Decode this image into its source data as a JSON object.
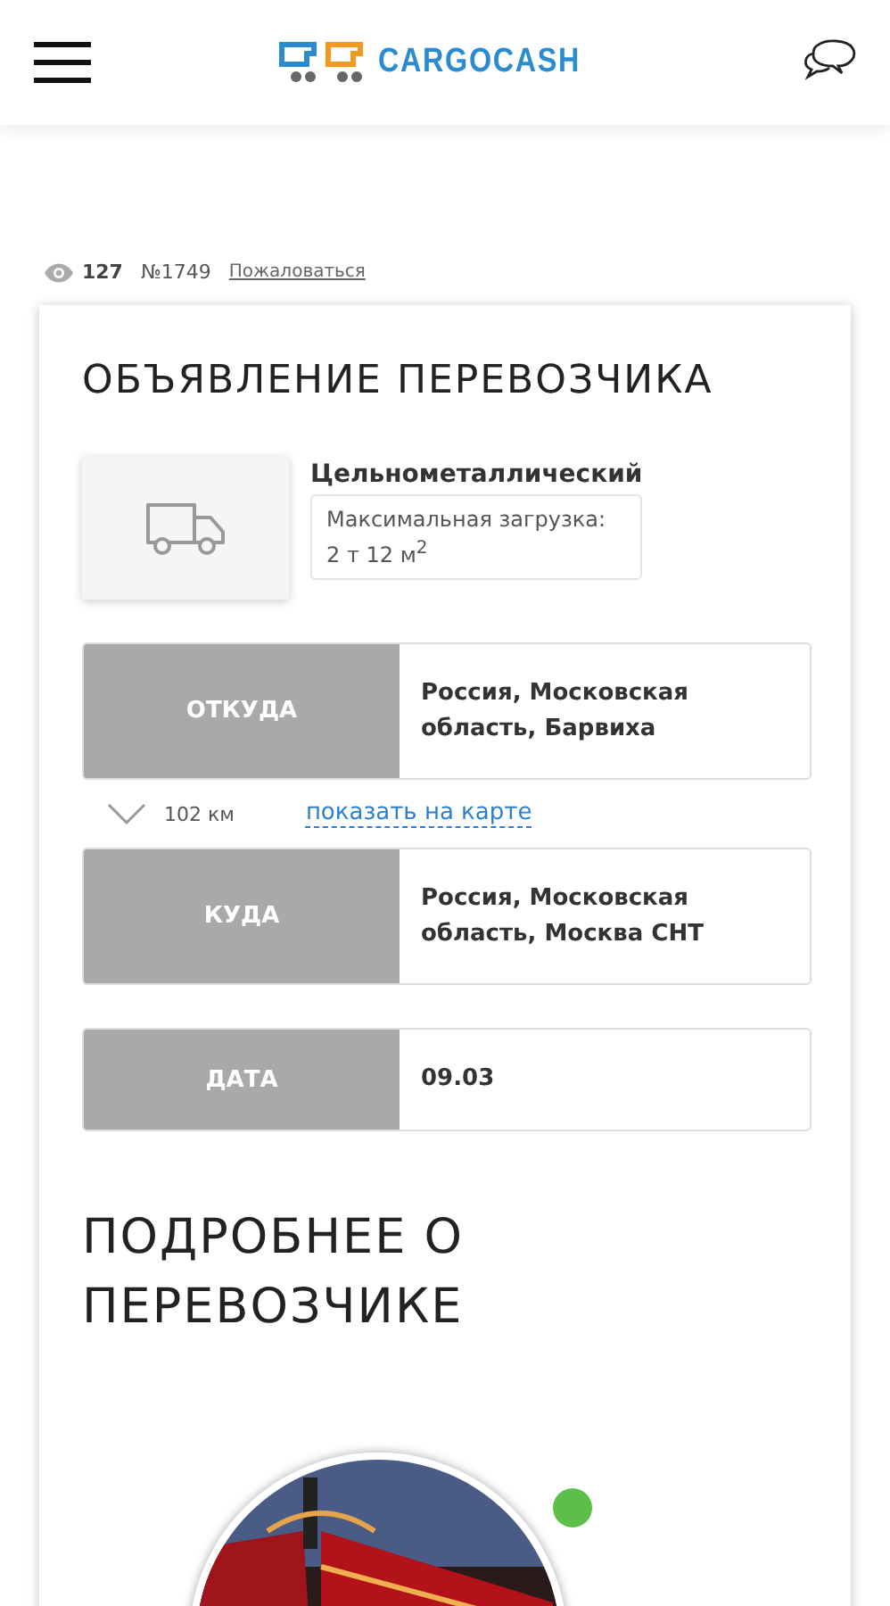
{
  "header": {
    "logo": "CARGOCASH"
  },
  "meta": {
    "views": "127",
    "number": "№1749",
    "report_link": "Пожаловаться"
  },
  "ad": {
    "title": "ОБЪЯВЛЕНИЕ ПЕРЕВОЗЧИКА",
    "vehicle": {
      "body_type": "Цельнометаллический",
      "capacity_label": "Максимальная загрузка:",
      "capacity": "2 т 12 м$^{2}$"
    },
    "route": [
      {
        "label": "ОТКУДА",
        "value": "Россия, Московская область, Барвиха"
      },
      {
        "kind": "distance",
        "distance": "102 км",
        "map_link": "показать на карте"
      },
      {
        "label": "КУДА",
        "value": "Россия, Московская область, Москва СНТ"
      },
      {
        "label": "ДАТА",
        "value": "09.03"
      }
    ]
  },
  "carrier": {
    "title": "ПОДРОБНЕЕ О ПЕРЕВОЗЧИКЕ",
    "avatar": {
      "kind": "picture",
      "online": true
    }
  }
}
